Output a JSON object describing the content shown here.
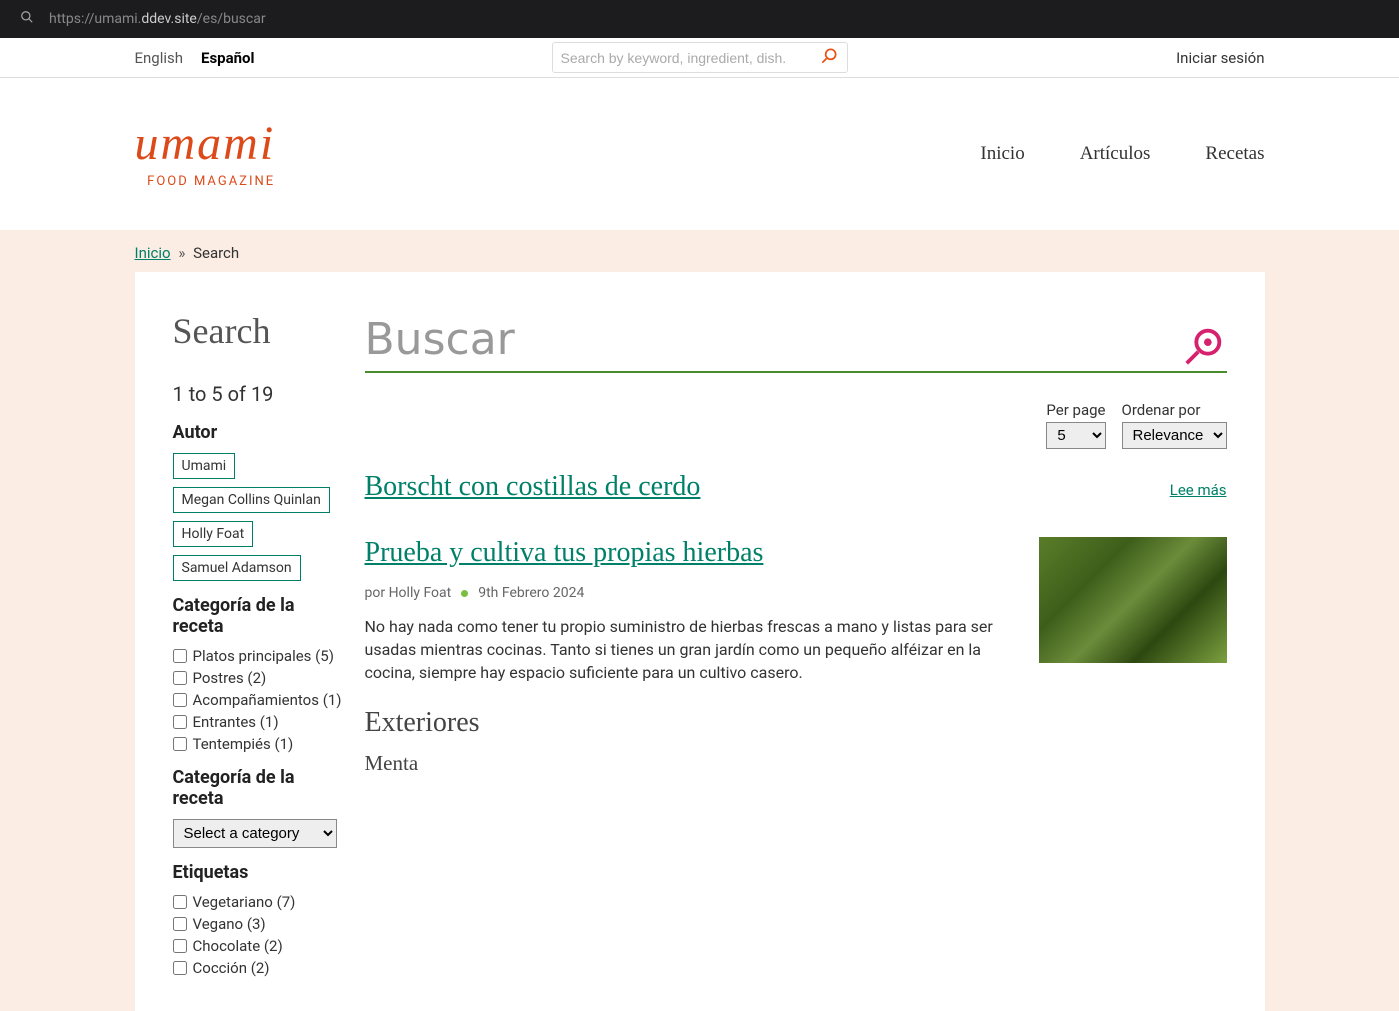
{
  "browser": {
    "url_prefix": "https://umami.",
    "url_host": "ddev.site",
    "url_path": "/es/buscar"
  },
  "topbar": {
    "lang_en": "English",
    "lang_es": "Español",
    "search_placeholder": "Search by keyword, ingredient, dish.",
    "login": "Iniciar sesión"
  },
  "logo": {
    "script": "umami",
    "sub": "FOOD MAGAZINE"
  },
  "nav": {
    "home": "Inicio",
    "articles": "Artículos",
    "recipes": "Recetas"
  },
  "breadcrumb": {
    "home": "Inicio",
    "sep": "»",
    "current": "Search"
  },
  "page_title": "Search",
  "result_count": "1 to 5 of 19",
  "facets": {
    "author_title": "Autor",
    "authors": [
      "Umami",
      "Megan Collins Quinlan",
      "Holly Foat",
      "Samuel Adamson"
    ],
    "cat_title": "Categoría de la receta",
    "categories": [
      "Platos principales (5)",
      "Postres (2)",
      "Acompañamientos (1)",
      "Entrantes (1)",
      "Tentempiés (1)"
    ],
    "cat_select_title": "Categoría de la receta",
    "cat_select_value": "Select a category",
    "tags_title": "Etiquetas",
    "tags": [
      "Vegetariano (7)",
      "Vegano (3)",
      "Chocolate (2)",
      "Cocción (2)"
    ]
  },
  "main_search_placeholder": "Buscar",
  "controls": {
    "per_page_label": "Per page",
    "per_page_value": "5",
    "sort_label": "Ordenar por",
    "sort_value": "Relevance"
  },
  "results": [
    {
      "title": "Borscht con costillas de cerdo",
      "read_more": "Lee más"
    },
    {
      "title": "Prueba y cultiva tus propias hierbas",
      "author_prefix": "por ",
      "author": "Holly Foat",
      "date": "9th Febrero 2024",
      "excerpt": "No hay nada como tener tu propio suministro de hierbas frescas a mano y listas para ser usadas mientras cocinas. Tanto si tienes un gran jardín como un pequeño alféizar en la cocina, siempre hay espacio suficiente para un cultivo casero.",
      "h2": "Exteriores",
      "h3": "Menta"
    }
  ]
}
